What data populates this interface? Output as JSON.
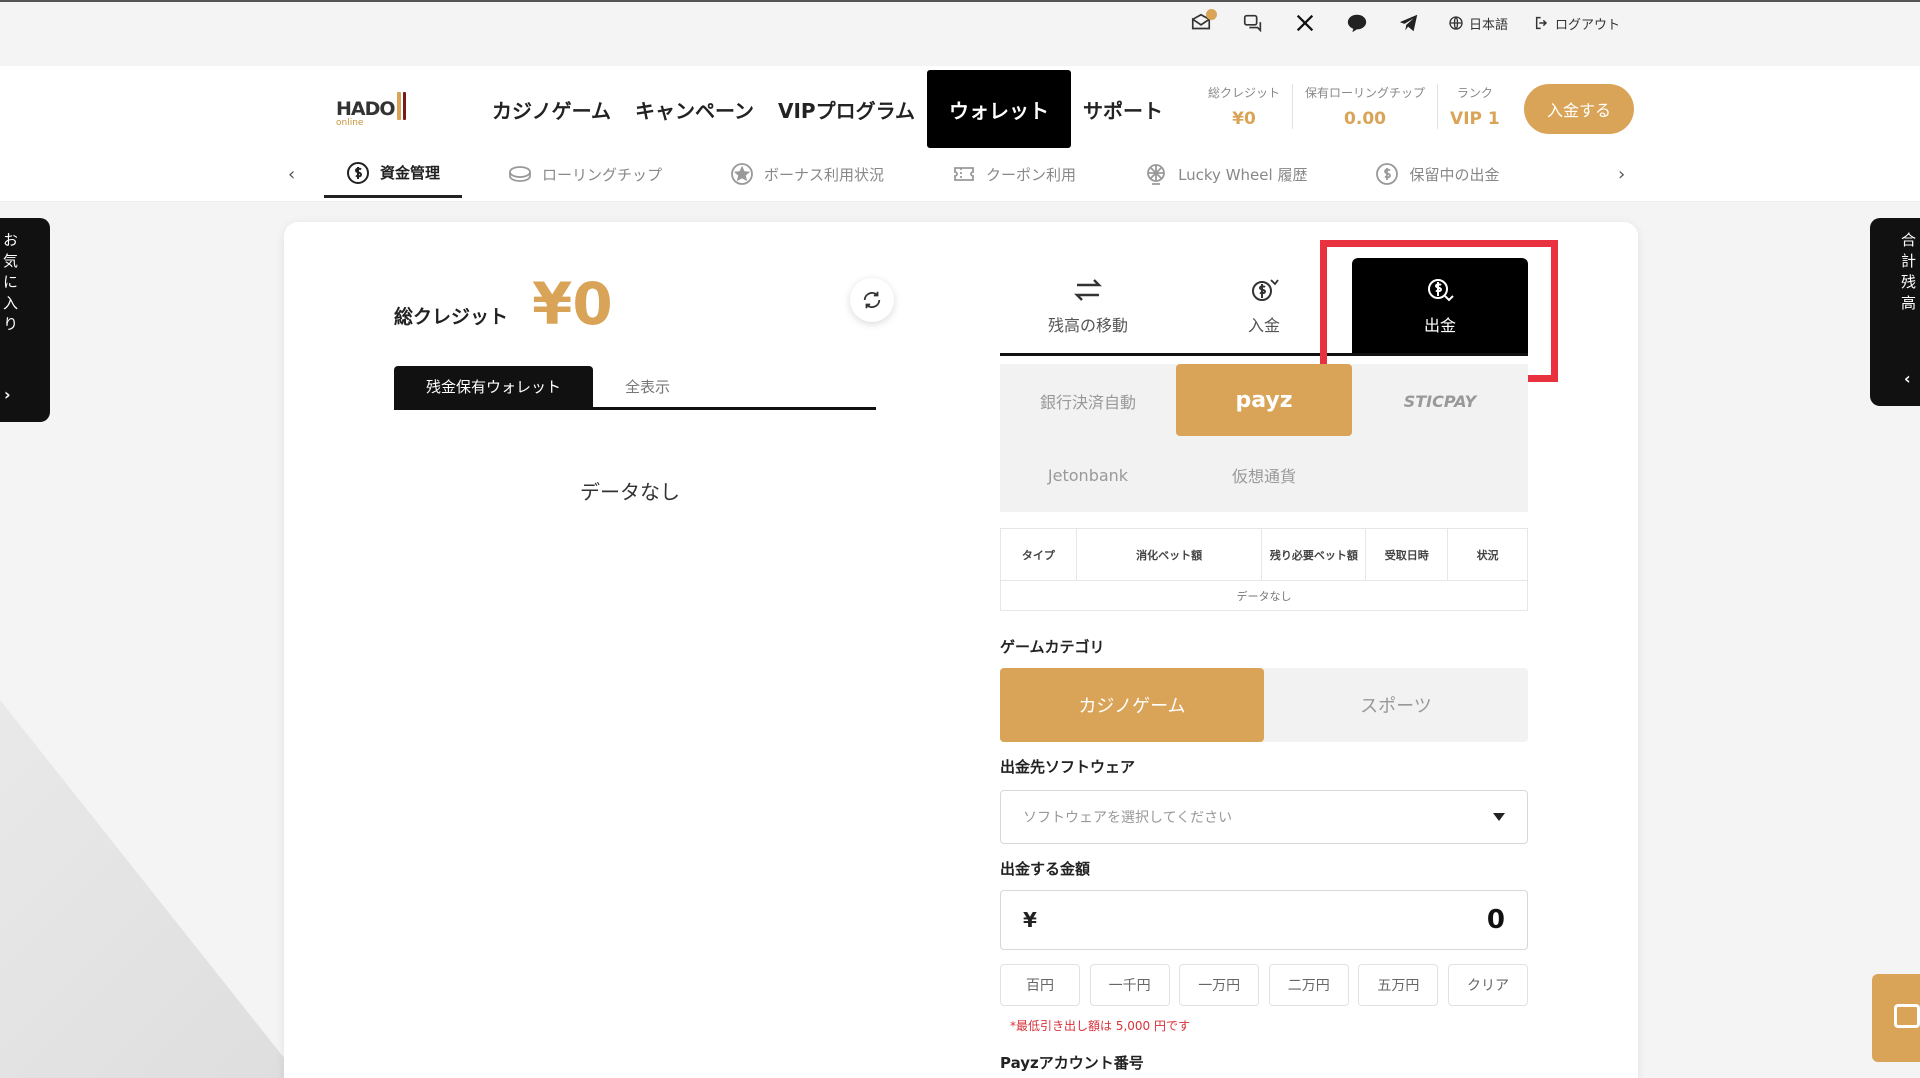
{
  "utility": {
    "language": "日本語",
    "logout": "ログアウト"
  },
  "logo": {
    "main": "HADO",
    "sub": "online"
  },
  "nav": {
    "items": [
      {
        "label": "カジノゲーム"
      },
      {
        "label": "キャンペーン"
      },
      {
        "label": "VIPプログラム"
      },
      {
        "label": "ウォレット",
        "active": true
      },
      {
        "label": "サポート"
      }
    ]
  },
  "stats": [
    {
      "label": "総クレジット",
      "value": "¥0"
    },
    {
      "label": "保有ローリングチップ",
      "value": "0.00"
    },
    {
      "label": "ランク",
      "value": "VIP 1"
    }
  ],
  "header": {
    "deposit_button": "入金する"
  },
  "subnav": {
    "items": [
      {
        "label": "資金管理",
        "icon": "dollar-circle-icon",
        "active": true
      },
      {
        "label": "ローリングチップ",
        "icon": "chip-icon"
      },
      {
        "label": "ボーナス利用状況",
        "icon": "star-badge-icon"
      },
      {
        "label": "クーポン利用",
        "icon": "coupon-icon"
      },
      {
        "label": "Lucky Wheel 履歴",
        "icon": "wheel-icon"
      },
      {
        "label": "保留中の出金",
        "icon": "dollar-circle-icon"
      }
    ]
  },
  "side": {
    "left": "お気に入り",
    "right": "合計残高"
  },
  "wallet": {
    "total_label": "総クレジット",
    "total_value": "¥0",
    "tabs": [
      {
        "label": "残金保有ウォレット",
        "active": true
      },
      {
        "label": "全表示"
      }
    ],
    "empty": "データなし"
  },
  "actions": {
    "tabs": [
      {
        "label": "残高の移動",
        "icon": "transfer-arrows-icon"
      },
      {
        "label": "入金",
        "icon": "deposit-icon"
      },
      {
        "label": "出金",
        "icon": "withdraw-icon",
        "active": true
      }
    ]
  },
  "methods": [
    {
      "label": "銀行決済自動"
    },
    {
      "label": "payz",
      "active": true
    },
    {
      "label": "STICPAY"
    },
    {
      "label": "Jetonbank"
    },
    {
      "label": "仮想通貨"
    }
  ],
  "table": {
    "headers": [
      "タイプ",
      "消化ベット額",
      "残り必要ベット額",
      "受取日時",
      "状況"
    ],
    "empty": "データなし"
  },
  "game_category": {
    "label": "ゲームカテゴリ",
    "options": [
      {
        "label": "カジノゲーム",
        "active": true
      },
      {
        "label": "スポーツ"
      }
    ]
  },
  "software": {
    "label": "出金先ソフトウェア",
    "placeholder": "ソフトウェアを選択してください"
  },
  "amount": {
    "label": "出金する金額",
    "currency": "¥",
    "value": "0"
  },
  "quick_amounts": [
    "百円",
    "一千円",
    "一万円",
    "二万円",
    "五万円",
    "クリア"
  ],
  "note": "*最低引き出し額は 5,000 円です",
  "payz_account_label": "Payzアカウント番号",
  "colors": {
    "accent": "#d9a458",
    "highlight": "#e8323f",
    "dark": "#111111"
  }
}
